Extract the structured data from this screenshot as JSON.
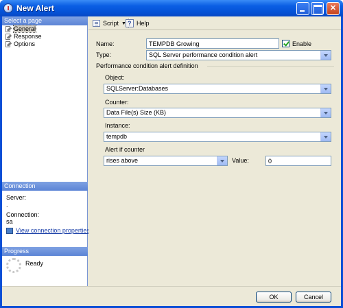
{
  "window": {
    "title": "New Alert"
  },
  "left": {
    "select_page_header": "Select a page",
    "pages": [
      {
        "label": "General",
        "icon": "wrench-page-icon"
      },
      {
        "label": "Response",
        "icon": "wrench-page-icon"
      },
      {
        "label": "Options",
        "icon": "wrench-page-icon"
      }
    ],
    "connection_header": "Connection",
    "server_label": "Server:",
    "server_value": ".",
    "connection_label": "Connection:",
    "connection_value": "sa",
    "view_connection_link": "View connection properties",
    "progress_header": "Progress",
    "progress_status": "Ready"
  },
  "toolbar": {
    "script_label": "Script",
    "help_label": "Help"
  },
  "form": {
    "name_label": "Name:",
    "name_value": "TEMPDB Growing",
    "enable_label": "Enable",
    "type_label": "Type:",
    "type_value": "SQL Server performance condition alert",
    "definition_label": "Performance condition alert definition",
    "object_label": "Object:",
    "object_value": "SQLServer:Databases",
    "counter_label": "Counter:",
    "counter_value": "Data File(s) Size (KB)",
    "instance_label": "Instance:",
    "instance_value": "tempdb",
    "alert_if_label": "Alert if counter",
    "alert_if_value": "rises above",
    "value_label": "Value:",
    "value_value": "0"
  },
  "buttons": {
    "ok": "OK",
    "cancel": "Cancel"
  }
}
